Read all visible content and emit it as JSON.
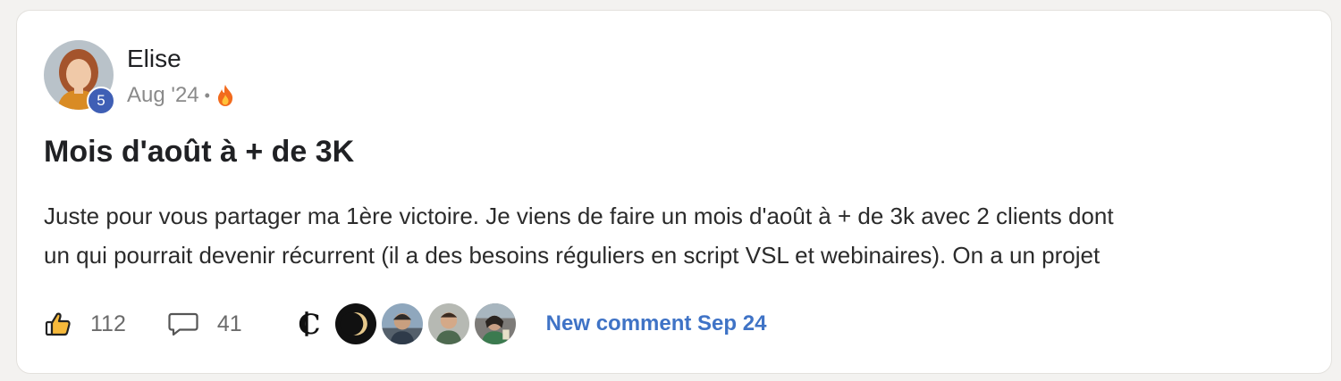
{
  "post": {
    "author": {
      "name": "Elise",
      "level": "5",
      "avatar_icon": "user-avatar-photo"
    },
    "meta": {
      "date": "Aug '24",
      "separator": "•",
      "badge_icon": "fire-icon"
    },
    "title": "Mois d'août à + de 3K",
    "body_lines": [
      "Juste pour vous partager ma 1ère victoire. Je viens de faire un mois d'août à + de 3k avec 2 clients dont",
      "un qui pourrait devenir récurrent (il a des besoins réguliers en script VSL et webinaires). On a un projet"
    ],
    "actions": {
      "likes": "112",
      "comments": "41",
      "like_icon": "thumbs-up-icon",
      "comment_icon": "speech-bubble-icon"
    },
    "commenter_avatars": [
      {
        "name": "commenter-avatar-1",
        "kind": "letter-logo"
      },
      {
        "name": "commenter-avatar-2",
        "kind": "moon-logo"
      },
      {
        "name": "commenter-avatar-3",
        "kind": "photo"
      },
      {
        "name": "commenter-avatar-4",
        "kind": "photo"
      },
      {
        "name": "commenter-avatar-5",
        "kind": "photo"
      }
    ],
    "new_comment": "New comment Sep 24"
  },
  "colors": {
    "accent_link": "#3f73c6",
    "level_badge": "#3f5fb5",
    "fire": "#f26b1d"
  }
}
